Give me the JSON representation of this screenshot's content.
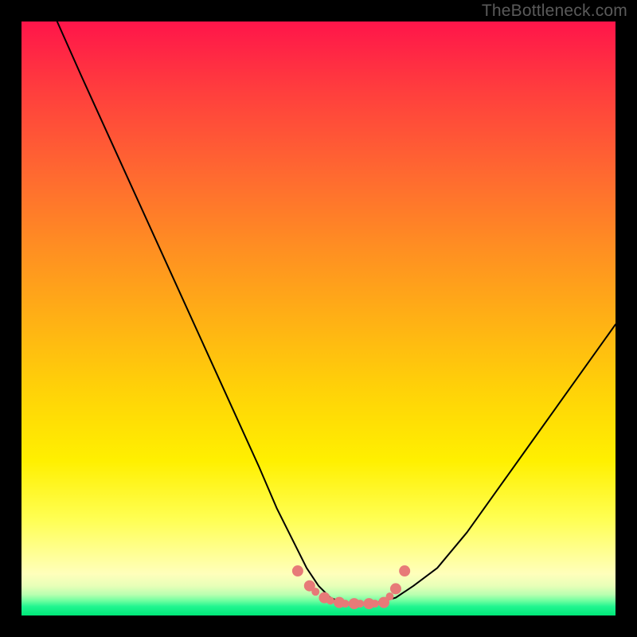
{
  "watermark": "TheBottleneck.com",
  "chart_data": {
    "type": "line",
    "title": "",
    "xlabel": "",
    "ylabel": "",
    "xlim": [
      0,
      100
    ],
    "ylim": [
      0,
      100
    ],
    "grid": false,
    "series": [
      {
        "name": "curve",
        "color": "#000000",
        "width": 2,
        "x": [
          6,
          10,
          15,
          20,
          25,
          30,
          35,
          40,
          43,
          46,
          48,
          50,
          52,
          54,
          56,
          58,
          60,
          63,
          66,
          70,
          75,
          80,
          85,
          90,
          95,
          100
        ],
        "y": [
          100,
          91,
          80,
          69,
          58,
          47,
          36,
          25,
          18,
          12,
          8,
          5,
          3,
          2.2,
          2,
          2,
          2.2,
          3,
          5,
          8,
          14,
          21,
          28,
          35,
          42,
          49
        ]
      }
    ],
    "markers": [
      {
        "name": "trough-dots",
        "color": "#e77a78",
        "size": 14,
        "x": [
          46.5,
          48.5,
          51,
          53.5,
          56,
          58.5,
          61,
          63,
          64.5
        ],
        "y": [
          7.5,
          5,
          3,
          2.2,
          2,
          2,
          2.2,
          4.5,
          7.5
        ]
      },
      {
        "name": "trough-overlap-dots",
        "color": "#e77a78",
        "size": 10,
        "x": [
          49.5,
          52,
          54.5,
          57,
          59.5,
          62
        ],
        "y": [
          4,
          2.5,
          2,
          2,
          2,
          3.2
        ]
      }
    ]
  }
}
